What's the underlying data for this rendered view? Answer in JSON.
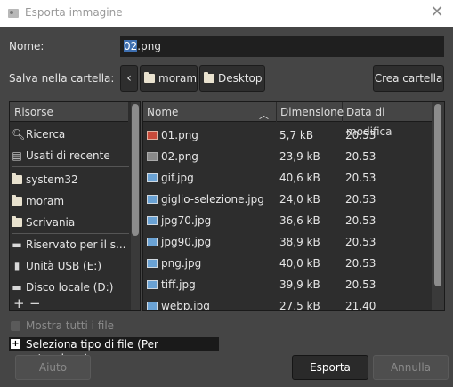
{
  "window": {
    "title": "Esporta immagine"
  },
  "name_field": {
    "label": "Nome:",
    "value_selected": "02",
    "value_rest": ".png"
  },
  "folder": {
    "label": "Salva nella cartella:",
    "crumbs": [
      "moram",
      "Desktop"
    ],
    "create_label": "Crea cartella"
  },
  "places": {
    "header": "Risorse",
    "items": [
      {
        "label": "Ricerca",
        "icon": "search-icon"
      },
      {
        "label": "Usati di recente",
        "icon": "recent-icon"
      },
      {
        "label": "system32",
        "icon": "folder-icon"
      },
      {
        "label": "moram",
        "icon": "folder-icon"
      },
      {
        "label": "Scrivania",
        "icon": "folder-icon"
      },
      {
        "label": "Riservato per il s...",
        "icon": "drive-icon"
      },
      {
        "label": "Unità USB (E:)",
        "icon": "usb-drive-icon"
      },
      {
        "label": "Disco locale (D:)",
        "icon": "drive-icon"
      }
    ],
    "add_symbol": "+",
    "remove_symbol": "−"
  },
  "files": {
    "columns": {
      "name": "Nome",
      "size": "Dimensione",
      "modified": "Data di modifica"
    },
    "rows": [
      {
        "name": "01.png",
        "size": "5,7 kB",
        "modified": "20.53",
        "icon": "red"
      },
      {
        "name": "02.png",
        "size": "23,9 kB",
        "modified": "20.53",
        "icon": "gray"
      },
      {
        "name": "gif.jpg",
        "size": "40,6 kB",
        "modified": "20.53",
        "icon": "blue"
      },
      {
        "name": "giglio-selezione.jpg",
        "size": "24,0 kB",
        "modified": "20.53",
        "icon": "blue"
      },
      {
        "name": "jpg70.jpg",
        "size": "36,6 kB",
        "modified": "20.53",
        "icon": "blue"
      },
      {
        "name": "jpg90.jpg",
        "size": "38,9 kB",
        "modified": "20.53",
        "icon": "blue"
      },
      {
        "name": "png.jpg",
        "size": "40,0 kB",
        "modified": "20.53",
        "icon": "blue"
      },
      {
        "name": "tiff.jpg",
        "size": "39,9 kB",
        "modified": "20.53",
        "icon": "blue"
      },
      {
        "name": "webp.jpg",
        "size": "27,5 kB",
        "modified": "21.40",
        "icon": "blue"
      }
    ]
  },
  "options": {
    "show_all": "Mostra tutti i file",
    "select_type": "Seleziona tipo di file (Per estensione)"
  },
  "buttons": {
    "help": "Aiuto",
    "export": "Esporta",
    "cancel": "Annulla"
  }
}
